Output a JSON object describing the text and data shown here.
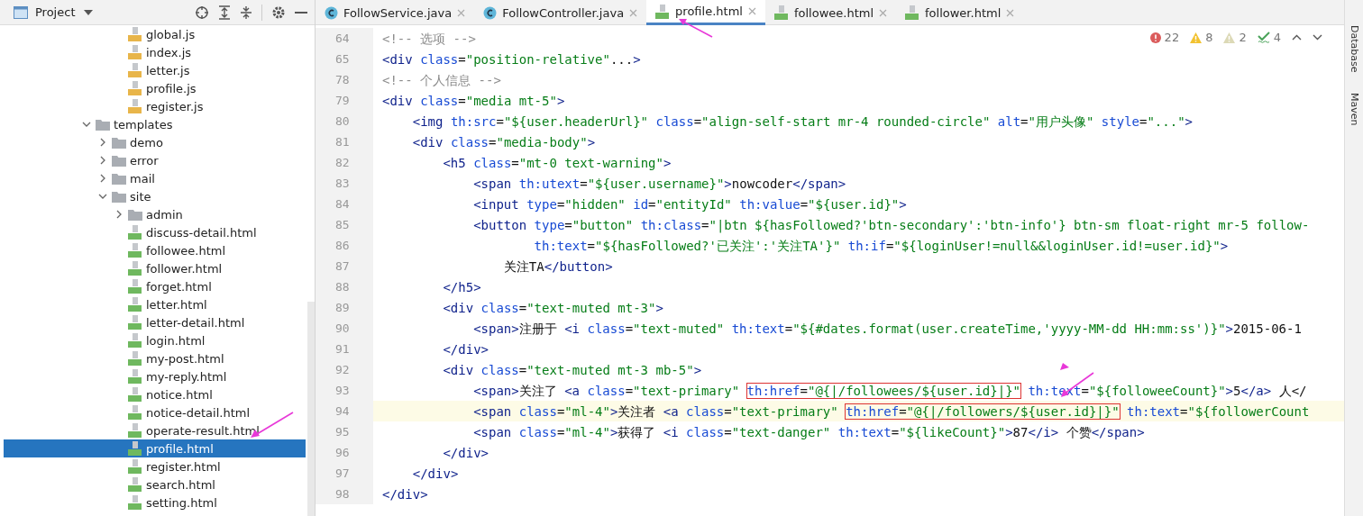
{
  "project_panel": {
    "title": "Project",
    "tree": {
      "partial_items": [
        {
          "name": "global.js",
          "kind": "js",
          "selected": false
        },
        {
          "name": "index.js",
          "kind": "js",
          "selected": false
        },
        {
          "name": "letter.js",
          "kind": "js",
          "selected": false
        },
        {
          "name": "profile.js",
          "kind": "js",
          "selected": false
        },
        {
          "name": "register.js",
          "kind": "js",
          "selected": false
        }
      ],
      "items": [
        {
          "name": "templates",
          "kind": "folder",
          "expanded": true,
          "selected": false,
          "children": [
            {
              "name": "demo",
              "kind": "folder",
              "expanded": false,
              "selected": false
            },
            {
              "name": "error",
              "kind": "folder",
              "expanded": false,
              "selected": false
            },
            {
              "name": "mail",
              "kind": "folder",
              "expanded": false,
              "selected": false
            },
            {
              "name": "site",
              "kind": "folder",
              "expanded": true,
              "selected": false,
              "children": [
                {
                  "name": "admin",
                  "kind": "folder",
                  "expanded": false,
                  "selected": false
                },
                {
                  "name": "discuss-detail.html",
                  "kind": "html",
                  "selected": false
                },
                {
                  "name": "followee.html",
                  "kind": "html",
                  "selected": false
                },
                {
                  "name": "follower.html",
                  "kind": "html",
                  "selected": false
                },
                {
                  "name": "forget.html",
                  "kind": "html",
                  "selected": false
                },
                {
                  "name": "letter.html",
                  "kind": "html",
                  "selected": false
                },
                {
                  "name": "letter-detail.html",
                  "kind": "html",
                  "selected": false
                },
                {
                  "name": "login.html",
                  "kind": "html",
                  "selected": false
                },
                {
                  "name": "my-post.html",
                  "kind": "html",
                  "selected": false
                },
                {
                  "name": "my-reply.html",
                  "kind": "html",
                  "selected": false
                },
                {
                  "name": "notice.html",
                  "kind": "html",
                  "selected": false
                },
                {
                  "name": "notice-detail.html",
                  "kind": "html",
                  "selected": false
                },
                {
                  "name": "operate-result.html",
                  "kind": "html",
                  "selected": false
                },
                {
                  "name": "profile.html",
                  "kind": "html",
                  "selected": true
                },
                {
                  "name": "register.html",
                  "kind": "html",
                  "selected": false
                },
                {
                  "name": "search.html",
                  "kind": "html",
                  "selected": false
                },
                {
                  "name": "setting.html",
                  "kind": "html",
                  "selected": false
                }
              ]
            }
          ]
        }
      ]
    }
  },
  "tabs": [
    {
      "label": "FollowService.java",
      "kind": "java",
      "selected": false
    },
    {
      "label": "FollowController.java",
      "kind": "java",
      "selected": false
    },
    {
      "label": "profile.html",
      "kind": "html",
      "selected": true
    },
    {
      "label": "followee.html",
      "kind": "html",
      "selected": false
    },
    {
      "label": "follower.html",
      "kind": "html",
      "selected": false
    }
  ],
  "inspections": [
    {
      "kind": "error",
      "count": "22"
    },
    {
      "kind": "warning",
      "count": "8"
    },
    {
      "kind": "weak",
      "count": "2"
    },
    {
      "kind": "typo",
      "count": "4"
    }
  ],
  "code_lines": [
    {
      "number": "64",
      "current": false,
      "text": "<!-- 选项 -->"
    },
    {
      "number": "65",
      "current": false,
      "text": "<div class=\"position-relative\"...>"
    },
    {
      "number": "78",
      "current": false,
      "text": "<!-- 个人信息 -->"
    },
    {
      "number": "79",
      "current": false,
      "text": "<div class=\"media mt-5\">"
    },
    {
      "number": "80",
      "current": false,
      "text": "    <img th:src=\"${user.headerUrl}\" class=\"align-self-start mr-4 rounded-circle\" alt=\"用户头像\" style=\"...\">"
    },
    {
      "number": "81",
      "current": false,
      "text": "    <div class=\"media-body\">"
    },
    {
      "number": "82",
      "current": false,
      "text": "        <h5 class=\"mt-0 text-warning\">"
    },
    {
      "number": "83",
      "current": false,
      "text": "            <span th:utext=\"${user.username}\">nowcoder</span>"
    },
    {
      "number": "84",
      "current": false,
      "text": "            <input type=\"hidden\" id=\"entityId\" th:value=\"${user.id}\">"
    },
    {
      "number": "85",
      "current": false,
      "text": "            <button type=\"button\" th:class=\"|btn ${hasFollowed?'btn-secondary':'btn-info'} btn-sm float-right mr-5 follow-"
    },
    {
      "number": "86",
      "current": false,
      "text": "                    th:text=\"${hasFollowed?'已关注':'关注TA'}\" th:if=\"${loginUser!=null&&loginUser.id!=user.id}\">"
    },
    {
      "number": "87",
      "current": false,
      "text": "                关注TA</button>"
    },
    {
      "number": "88",
      "current": false,
      "text": "        </h5>"
    },
    {
      "number": "89",
      "current": false,
      "text": "        <div class=\"text-muted mt-3\">"
    },
    {
      "number": "90",
      "current": false,
      "text": "            <span>注册于 <i class=\"text-muted\" th:text=\"${#dates.format(user.createTime,'yyyy-MM-dd HH:mm:ss')}\">2015-06-1"
    },
    {
      "number": "91",
      "current": false,
      "text": "        </div>"
    },
    {
      "number": "92",
      "current": false,
      "text": "        <div class=\"text-muted mt-3 mb-5\">"
    },
    {
      "number": "93",
      "current": false,
      "segments": [
        {
          "text": "            <span>关注了 <a class=\"text-primary\" ",
          "boxed": false
        },
        {
          "text": "th:href=\"@{|/followees/${user.id}|}\"",
          "boxed": true
        },
        {
          "text": " th:text=\"${followeeCount}\">5</a> 人</",
          "boxed": false
        }
      ]
    },
    {
      "number": "94",
      "current": true,
      "segments": [
        {
          "text": "            <span class=\"ml-4\">关注者 <a class=\"text-primary\" ",
          "boxed": false
        },
        {
          "text": "th:href=\"@{|/followers/${user.id}|}\"",
          "boxed": true
        },
        {
          "text": " th:text=\"${followerCount",
          "boxed": false
        }
      ]
    },
    {
      "number": "95",
      "current": false,
      "text": "            <span class=\"ml-4\">获得了 <i class=\"text-danger\" th:text=\"${likeCount}\">87</i> 个赞</span>"
    },
    {
      "number": "96",
      "current": false,
      "text": "        </div>"
    },
    {
      "number": "97",
      "current": false,
      "text": "    </div>"
    },
    {
      "number": "98",
      "current": false,
      "text": "</div>"
    }
  ],
  "right_toolbar": [
    "Database",
    "Maven"
  ]
}
